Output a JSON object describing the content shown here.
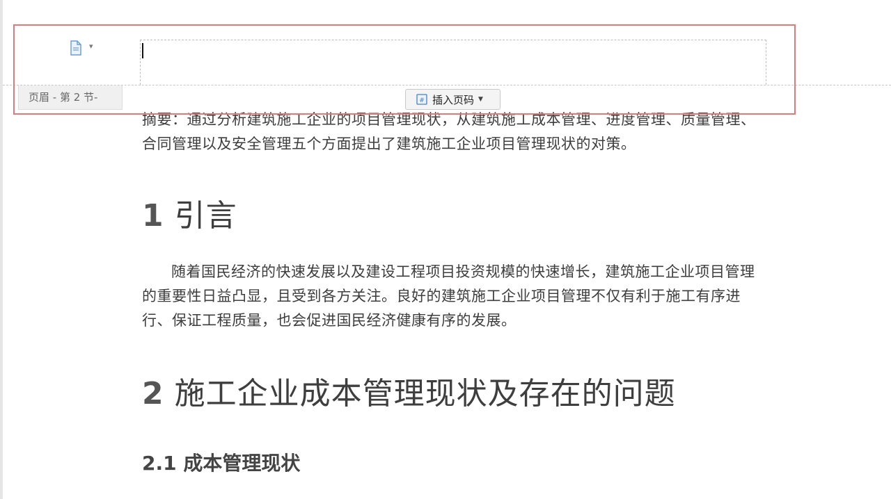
{
  "header_area": {
    "tag_label": "页眉  - 第 2 节-",
    "insert_page_number_label": "插入页码",
    "doc_menu_caret": "▾"
  },
  "document": {
    "abstract": "摘要：通过分析建筑施工企业的项目管理现状，从建筑施工成本管理、进度管理、质量管理、合同管理以及安全管理五个方面提出了建筑施工企业项目管理现状的对策。",
    "section1": {
      "number": "1",
      "title": "引言",
      "paragraph": "随着国民经济的快速发展以及建设工程项目投资规模的快速增长，建筑施工企业项目管理的重要性日益凸显，且受到各方关注。良好的建筑施工企业项目管理不仅有利于施工有序进行、保证工程质量，也会促进国民经济健康有序的发展。"
    },
    "section2": {
      "number": "2",
      "title": "施工企业成本管理现状及存在的问题",
      "subsection": {
        "number": "2.1",
        "title": "成本管理现状"
      }
    }
  },
  "colors": {
    "highlight_border": "#e07a7a",
    "page_background": "#ffffff",
    "icon_blue": "#6a9bd8"
  }
}
